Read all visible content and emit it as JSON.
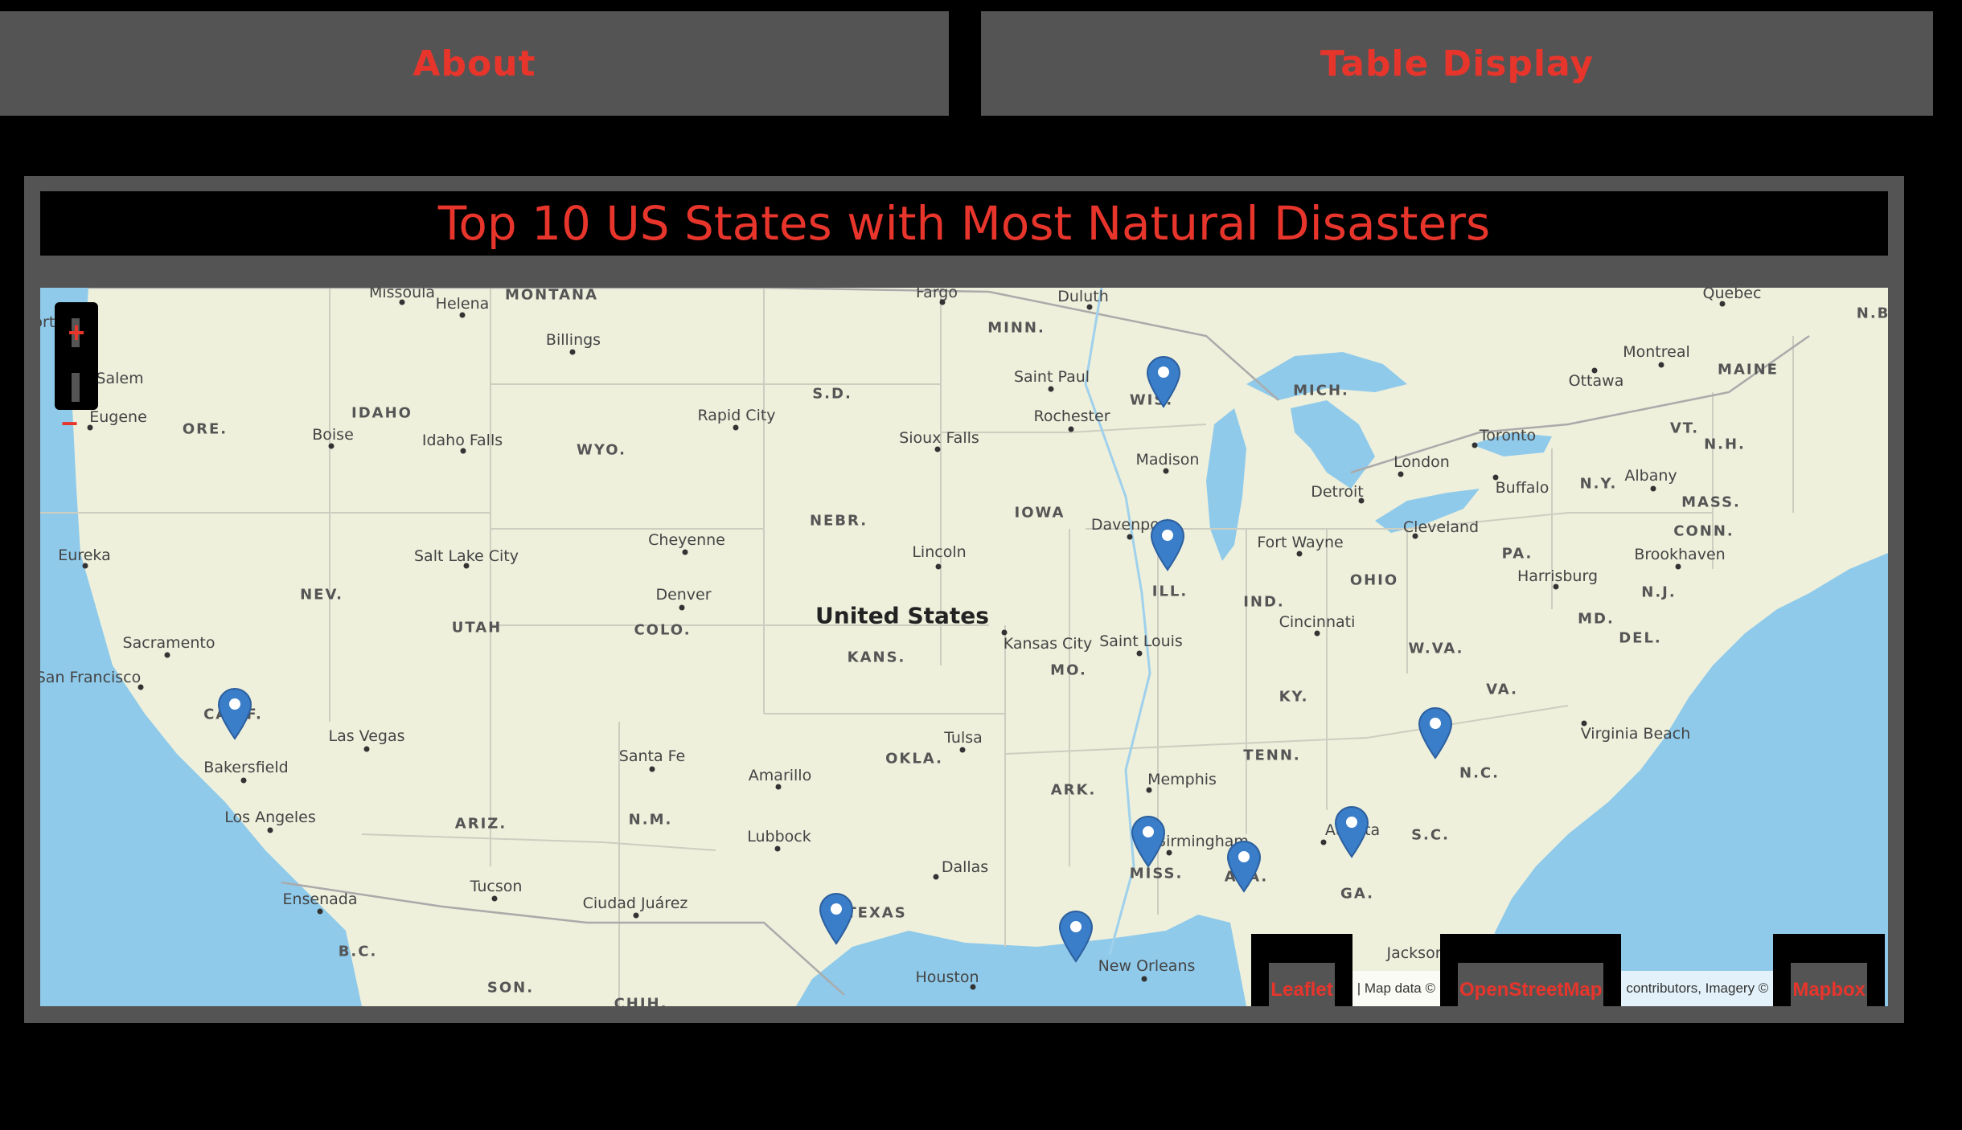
{
  "nav": {
    "about_label": "About",
    "table_label": "Table Display"
  },
  "panel": {
    "title": "Top 10 US States with Most Natural Disasters"
  },
  "map": {
    "zoom_in": "+",
    "zoom_out": "−",
    "country_label": "United States",
    "state_labels": [
      "MONTANA",
      "MINN.",
      "IDAHO",
      "ORE.",
      "S.D.",
      "WYO.",
      "WIS.",
      "MICH.",
      "IOWA",
      "NEBR.",
      "NEV.",
      "UTAH",
      "COLO.",
      "KANS.",
      "ILL.",
      "IND.",
      "OHIO",
      "PA.",
      "MO.",
      "KY.",
      "W.VA.",
      "VA.",
      "TENN.",
      "N.C.",
      "OKLA.",
      "ARK.",
      "ARIZ.",
      "N.M.",
      "MISS.",
      "ALA.",
      "GA.",
      "S.C.",
      "TEXAS",
      "CALIF.",
      "B.C.",
      "SON.",
      "CHIH.",
      "MAINE",
      "VT.",
      "N.H.",
      "N.Y.",
      "MASS.",
      "CONN.",
      "N.J.",
      "DEL.",
      "MD.",
      "N.B."
    ],
    "city_labels": [
      "Missoula",
      "Helena",
      "Fargo",
      "Duluth",
      "Quebec",
      "Billings",
      "Salem",
      "Eugene",
      "Boise",
      "Idaho Falls",
      "Rapid City",
      "Saint Paul",
      "Rochester",
      "Sioux Falls",
      "Madison",
      "Montreal",
      "Ottawa",
      "Toronto",
      "London",
      "Detroit",
      "Buffalo",
      "Albany",
      "Eureka",
      "Salt Lake City",
      "Cheyenne",
      "Lincoln",
      "Davenport",
      "Fort Wayne",
      "Cleveland",
      "Harrisburg",
      "Brookhaven",
      "Denver",
      "Kansas City",
      "Saint Louis",
      "Cincinnati",
      "Sacramento",
      "San Francisco",
      "Las Vegas",
      "Bakersfield",
      "Los Angeles",
      "Santa Fe",
      "Amarillo",
      "Tulsa",
      "Memphis",
      "Virginia Beach",
      "Lubbock",
      "Birmingham",
      "Atlanta",
      "Dallas",
      "Tucson",
      "Ciudad Juárez",
      "Ensenada",
      "New Orleans",
      "Houston",
      "Jacksonville",
      "Portland"
    ],
    "markers": [
      "California",
      "Texas",
      "Louisiana",
      "Mississippi",
      "Alabama",
      "Georgia",
      "North Carolina",
      "Illinois",
      "Wisconsin"
    ],
    "attribution": {
      "leaflet": "Leaflet",
      "map_data": "| Map data ©",
      "osm": "OpenStreetMap",
      "contributors": "contributors, Imagery ©",
      "mapbox": "Mapbox"
    }
  },
  "colors": {
    "accent": "#e8352c",
    "panel": "#545454",
    "water": "#8fcaea",
    "land": "#eef0dc",
    "marker": "#3a7dc8"
  }
}
